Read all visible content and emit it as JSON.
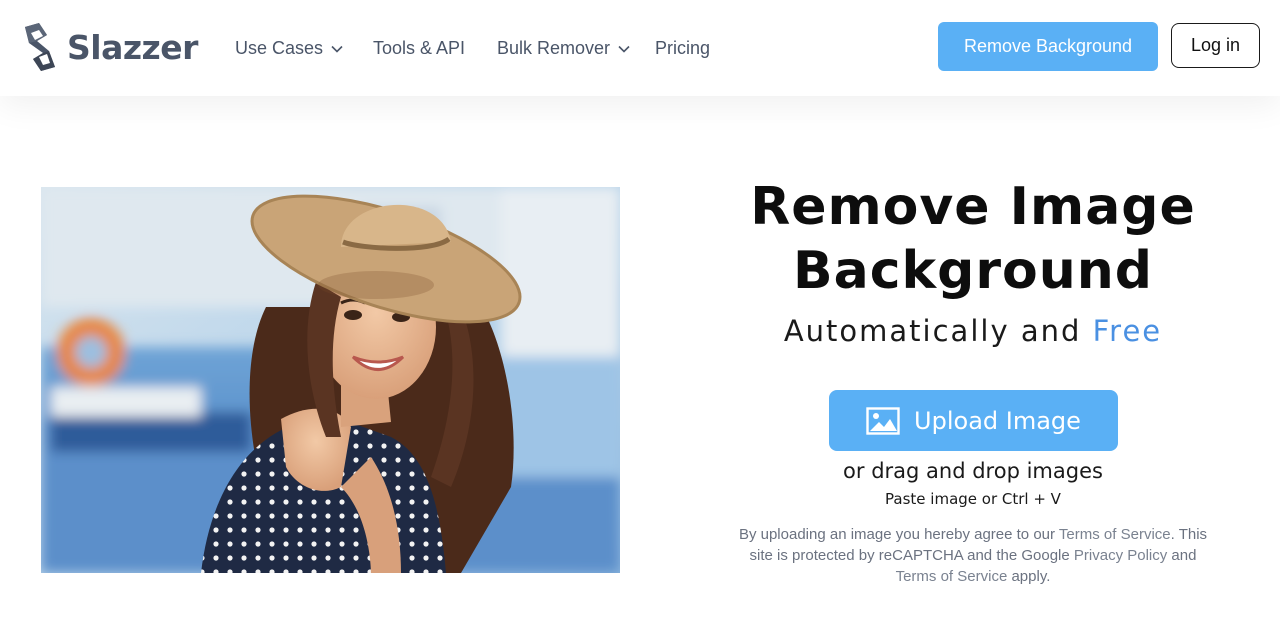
{
  "header": {
    "logo_text": "Slazzer",
    "nav": {
      "use_cases": "Use Cases",
      "tools_api": "Tools & API",
      "bulk_remover": "Bulk Remover",
      "pricing": "Pricing"
    },
    "remove_background_label": "Remove Background",
    "login_label": "Log in"
  },
  "colors": {
    "accent": "#5ab0f5",
    "free_highlight": "#4a90e2",
    "logo_gray": "#4a5568"
  },
  "hero": {
    "title_line1": "Remove Image",
    "title_line2": "Background",
    "subtitle_prefix": "Automatically and",
    "subtitle_highlight": "Free",
    "upload_label": "Upload Image",
    "upload_icon": "image-icon",
    "drag_text": "or drag and drop images",
    "paste_text": "Paste image or Ctrl + V"
  },
  "legal": {
    "part1": "By uploading an image you hereby agree to our",
    "terms_link_1": "Terms of Service",
    "part2": ". This site is protected by reCAPTCHA and the Google",
    "privacy_link": "Privacy Policy",
    "part3": "and",
    "terms_link_2": "Terms of Service",
    "part4": "apply."
  }
}
